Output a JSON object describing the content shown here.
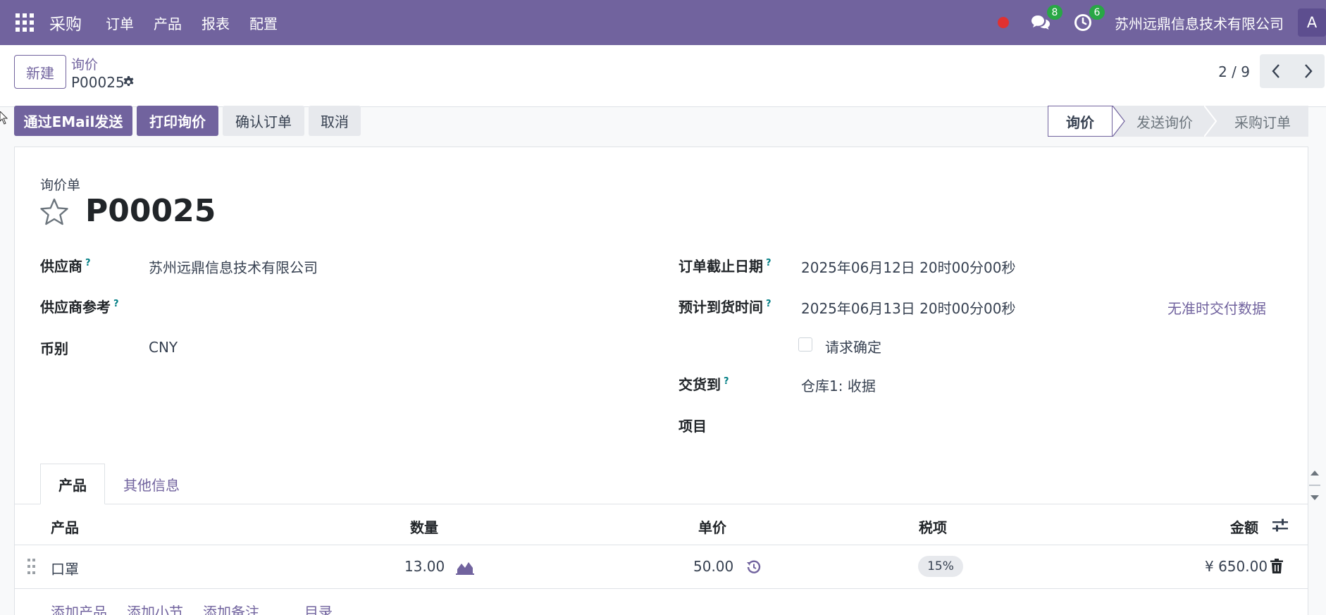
{
  "navbar": {
    "app_name": "采购",
    "menus": [
      "订单",
      "产品",
      "报表",
      "配置"
    ],
    "messages_count": "8",
    "activities_count": "6",
    "company": "苏州远鼎信息技术有限公司",
    "avatar_letter": "A"
  },
  "control_panel": {
    "new_label": "新建",
    "breadcrumb": "询价",
    "record_name": "P00025",
    "pager": "2 / 9"
  },
  "actions": {
    "send_email": "通过EMail发送",
    "print": "打印询价",
    "confirm": "确认订单",
    "cancel": "取消"
  },
  "stages": [
    "询价",
    "发送询价",
    "采购订单"
  ],
  "form": {
    "doc_type": "询价单",
    "title": "P00025",
    "supplier_label": "供应商",
    "supplier_value": "苏州远鼎信息技术有限公司",
    "supplier_ref_label": "供应商参考",
    "currency_label": "币别",
    "currency_value": "CNY",
    "deadline_label": "订单截止日期",
    "deadline_value": "2025年06月12日 20时00分00秒",
    "expected_label": "预计到货时间",
    "expected_value": "2025年06月13日 20时00分00秒",
    "ontime_link": "无准时交付数据",
    "request_confirm_label": "请求确定",
    "deliver_to_label": "交货到",
    "deliver_to_value": "仓库1: 收据",
    "project_label": "项目",
    "help_mark": "?"
  },
  "tabs": [
    "产品",
    "其他信息"
  ],
  "table": {
    "headers": [
      "产品",
      "数量",
      "单价",
      "税项",
      "金额"
    ],
    "rows": [
      {
        "product": "口罩",
        "qty": "13.00",
        "price": "50.00",
        "tax": "15%",
        "amount": "¥ 650.00"
      }
    ],
    "add_links": [
      "添加产品",
      "添加小节",
      "添加备注",
      "目录"
    ]
  },
  "colors": {
    "brand": "#71639e",
    "badge": "#28a745",
    "record": "#e03131"
  }
}
